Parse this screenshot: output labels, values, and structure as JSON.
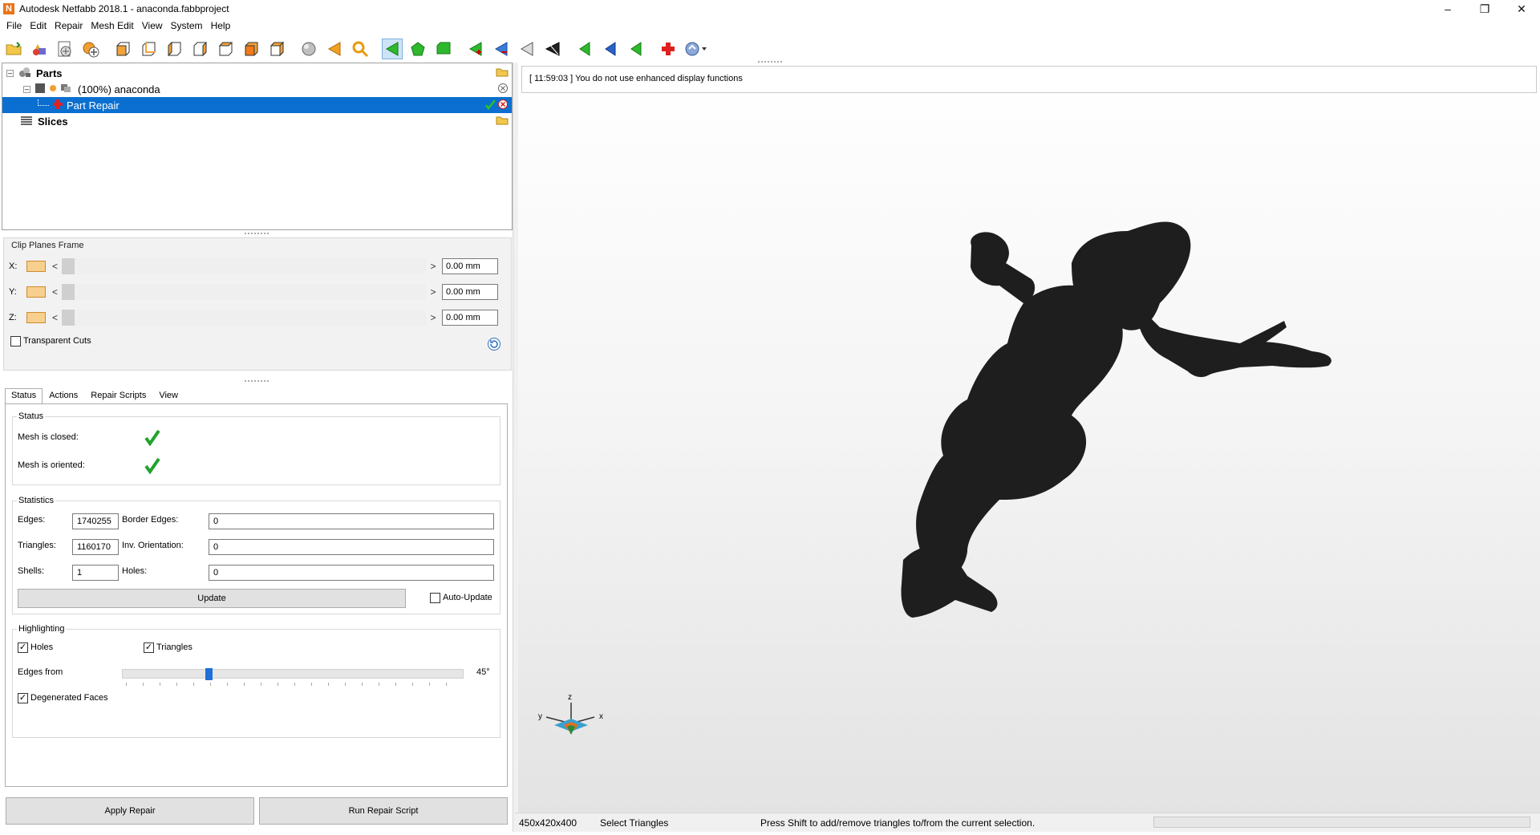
{
  "window": {
    "title": "Autodesk Netfabb 2018.1 - anaconda.fabbproject",
    "app_icon": "N"
  },
  "menu": [
    "File",
    "Edit",
    "Repair",
    "Mesh Edit",
    "View",
    "System",
    "Help"
  ],
  "tree": {
    "parts_label": "Parts",
    "part_label": "(100%) anaconda",
    "repair_label": "Part Repair",
    "slices_label": "Slices"
  },
  "clip": {
    "title": "Clip Planes Frame",
    "x_label": "X:",
    "y_label": "Y:",
    "z_label": "Z:",
    "x_value": "0.00 mm",
    "y_value": "0.00 mm",
    "z_value": "0.00 mm",
    "lt": "<",
    "gt": ">",
    "transparent_label": "Transparent Cuts"
  },
  "tabs": [
    "Status",
    "Actions",
    "Repair Scripts",
    "View"
  ],
  "status": {
    "title": "Status",
    "mesh_closed_label": "Mesh is closed:",
    "mesh_oriented_label": "Mesh is oriented:"
  },
  "stats": {
    "title": "Statistics",
    "edges_label": "Edges:",
    "edges_value": "1740255",
    "border_edges_label": "Border Edges:",
    "border_edges_value": "0",
    "triangles_label": "Triangles:",
    "triangles_value": "1160170",
    "inv_orientation_label": "Inv. Orientation:",
    "inv_orientation_value": "0",
    "shells_label": "Shells:",
    "shells_value": "1",
    "holes_label": "Holes:",
    "holes_value": "0",
    "update_label": "Update",
    "auto_update_label": "Auto-Update"
  },
  "highlighting": {
    "title": "Highlighting",
    "holes_label": "Holes",
    "triangles_label": "Triangles",
    "edges_from_label": "Edges from",
    "edges_from_value": "45°",
    "edges_from_fraction": 0.25,
    "degenerated_label": "Degenerated Faces"
  },
  "buttons": {
    "apply_repair": "Apply Repair",
    "run_script": "Run Repair Script"
  },
  "console_text": "[ 11:59:03 ] You do not use enhanced display functions",
  "axes": {
    "z": "z",
    "y": "y",
    "x": "x"
  },
  "statusbar": {
    "dims": "450x420x400",
    "mode": "Select Triangles",
    "hint": "Press Shift to add/remove triangles to/from the current selection."
  },
  "colors": {
    "selection": "#0a6fd0",
    "check_green": "#22a22b",
    "model": "#1e1e1e",
    "accent_orange": "#e8741a"
  },
  "icons": [
    "open-icon",
    "add-part-icon",
    "part-settings-icon",
    "add-icon",
    "view-front-icon",
    "view-back-icon",
    "view-left-icon",
    "view-right-icon",
    "view-top-icon",
    "view-bottom-icon",
    "view-iso-icon",
    "sphere-icon",
    "arrow-left-icon",
    "zoom-icon",
    "select-triangle-icon",
    "select-surface-icon",
    "select-shell-icon",
    "mark-icon",
    "unmark-icon",
    "triangle-tool-icon",
    "cut-tool-icon",
    "nav-first-icon",
    "nav-prev-icon",
    "nav-next-icon",
    "repair-cross-icon",
    "help-dropdown-icon"
  ]
}
